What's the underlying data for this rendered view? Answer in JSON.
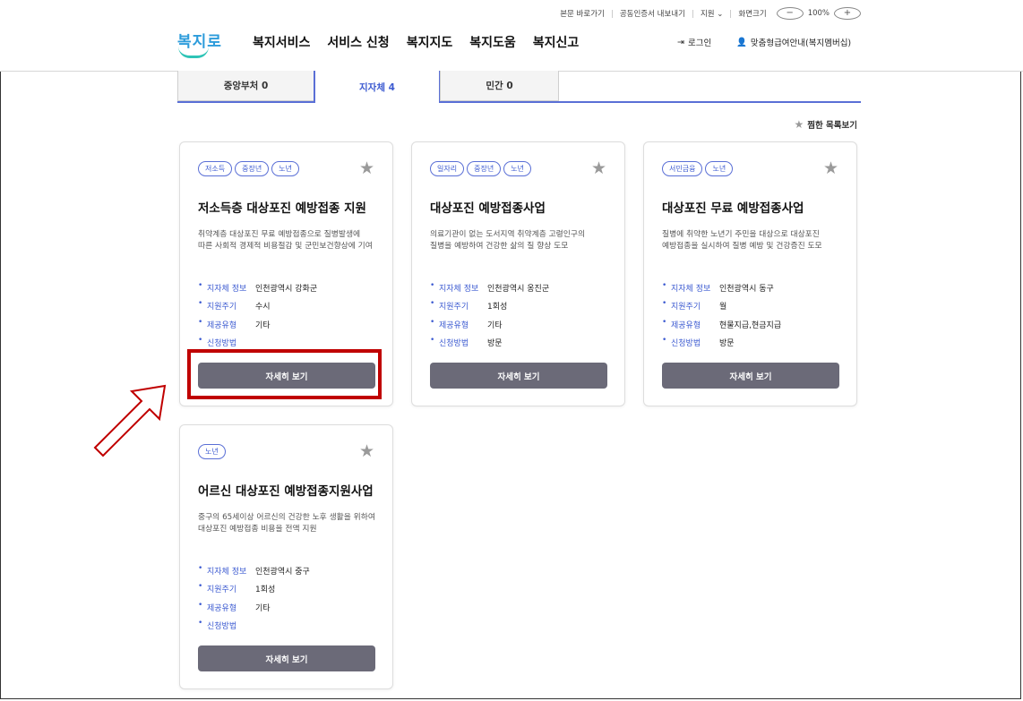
{
  "util_bar": {
    "skip": "본문 바로가기",
    "cert": "공동인증서 내보내기",
    "region": "지원",
    "zoom_label": "화면크기",
    "zoom_value": "100%"
  },
  "logo": "복지로",
  "gnb": [
    "복지서비스",
    "서비스 신청",
    "복지지도",
    "복지도움",
    "복지신고"
  ],
  "login": "로그인",
  "membership": "맞춤형급여안내(복지멤버십)",
  "tabs": [
    "중앙부처 0",
    "지자체 4",
    "민간 0"
  ],
  "wishlist": "찜한 목록보기",
  "labels": {
    "region": "지자체 정보",
    "cycle": "지원주기",
    "type": "제공유형",
    "method": "신청방법"
  },
  "detail_button": "자세히 보기",
  "cards": [
    {
      "tags": [
        "저소득",
        "중장년",
        "노년"
      ],
      "title": "저소득층 대상포진 예방접종 지원",
      "desc": "취약계층 대상포진 무료 예방접종으로 질병발생에 따른 사회적 경제적 비용절감 및 군민보건향상에 기여",
      "region": "인천광역시 강화군",
      "cycle": "수시",
      "type": "기타",
      "method": ""
    },
    {
      "tags": [
        "일자리",
        "중장년",
        "노년"
      ],
      "title": "대상포진 예방접종사업",
      "desc": "의료기관이 없는 도서지역 취약계층 고령인구의 질병을 예방하여 건강한 삶의 질 향상 도모",
      "region": "인천광역시 옹진군",
      "cycle": "1회성",
      "type": "기타",
      "method": "방문"
    },
    {
      "tags": [
        "서민금융",
        "노년"
      ],
      "title": "대상포진 무료 예방접종사업",
      "desc": "질병에 취약한 노년기 주민을 대상으로 대상포진 예방접종을 실시하여 질병 예방 및 건강증진 도모",
      "region": "인천광역시 동구",
      "cycle": "월",
      "type": "현물지급,현금지급",
      "method": "방문"
    },
    {
      "tags": [
        "노년"
      ],
      "title": "어르신 대상포진 예방접종지원사업",
      "desc": "중구의 65세이상 어르신의 건강한 노후 생활을 위하여 대상포진 예방접종 비용을 전액 지원",
      "region": "인천광역시 중구",
      "cycle": "1회성",
      "type": "기타",
      "method": ""
    }
  ]
}
